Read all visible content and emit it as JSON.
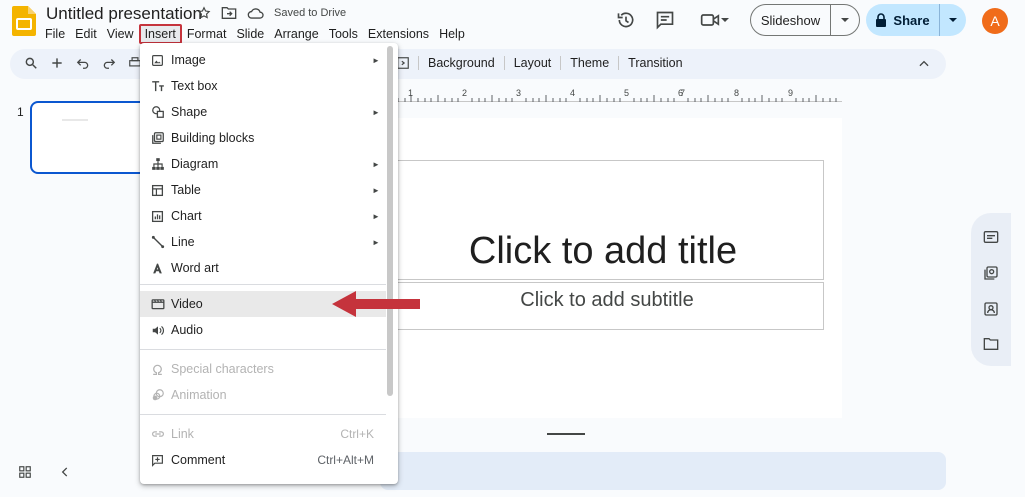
{
  "header": {
    "doc_title": "Untitled presentation",
    "saved_status": "Saved to Drive",
    "slideshow_label": "Slideshow",
    "share_label": "Share",
    "avatar_initial": "A"
  },
  "menubar": [
    "File",
    "Edit",
    "View",
    "Insert",
    "Format",
    "Slide",
    "Arrange",
    "Tools",
    "Extensions",
    "Help"
  ],
  "menubar_active": "Insert",
  "toolbar": {
    "background": "Background",
    "layout": "Layout",
    "theme": "Theme",
    "transition": "Transition"
  },
  "ruler_ticks": [
    "1",
    "2",
    "3",
    "4",
    "5",
    "6",
    "7",
    "8",
    "9"
  ],
  "filmstrip": {
    "slide_number": "1"
  },
  "slide": {
    "title_placeholder": "Click to add title",
    "subtitle_placeholder": "Click to add subtitle"
  },
  "insert_menu": {
    "items": [
      {
        "label": "Image",
        "icon": "image-icon",
        "submenu": true
      },
      {
        "label": "Text box",
        "icon": "text-box-icon",
        "submenu": false
      },
      {
        "label": "Shape",
        "icon": "shape-icon",
        "submenu": true
      },
      {
        "label": "Building blocks",
        "icon": "building-blocks-icon",
        "submenu": false
      },
      {
        "label": "Diagram",
        "icon": "diagram-icon",
        "submenu": true
      },
      {
        "label": "Table",
        "icon": "table-icon",
        "submenu": true
      },
      {
        "label": "Chart",
        "icon": "chart-icon",
        "submenu": true
      },
      {
        "label": "Line",
        "icon": "line-icon",
        "submenu": true
      },
      {
        "label": "Word art",
        "icon": "word-art-icon",
        "submenu": false
      },
      {
        "label": "Video",
        "icon": "video-icon",
        "submenu": false,
        "highlighted": true
      },
      {
        "label": "Audio",
        "icon": "audio-icon",
        "submenu": false
      },
      {
        "label": "Special characters",
        "icon": "omega-icon",
        "disabled": true
      },
      {
        "label": "Animation",
        "icon": "animation-icon",
        "disabled": true
      },
      {
        "label": "Link",
        "icon": "link-icon",
        "disabled": true,
        "shortcut": "Ctrl+K"
      },
      {
        "label": "Comment",
        "icon": "comment-icon",
        "shortcut": "Ctrl+Alt+M"
      }
    ]
  },
  "colors": {
    "accent_blue": "#0b57d0",
    "share_bg": "#c2e7ff",
    "annotation_red": "#c5333c",
    "avatar_bg": "#f06c1a",
    "logo_yellow": "#f4b400"
  }
}
